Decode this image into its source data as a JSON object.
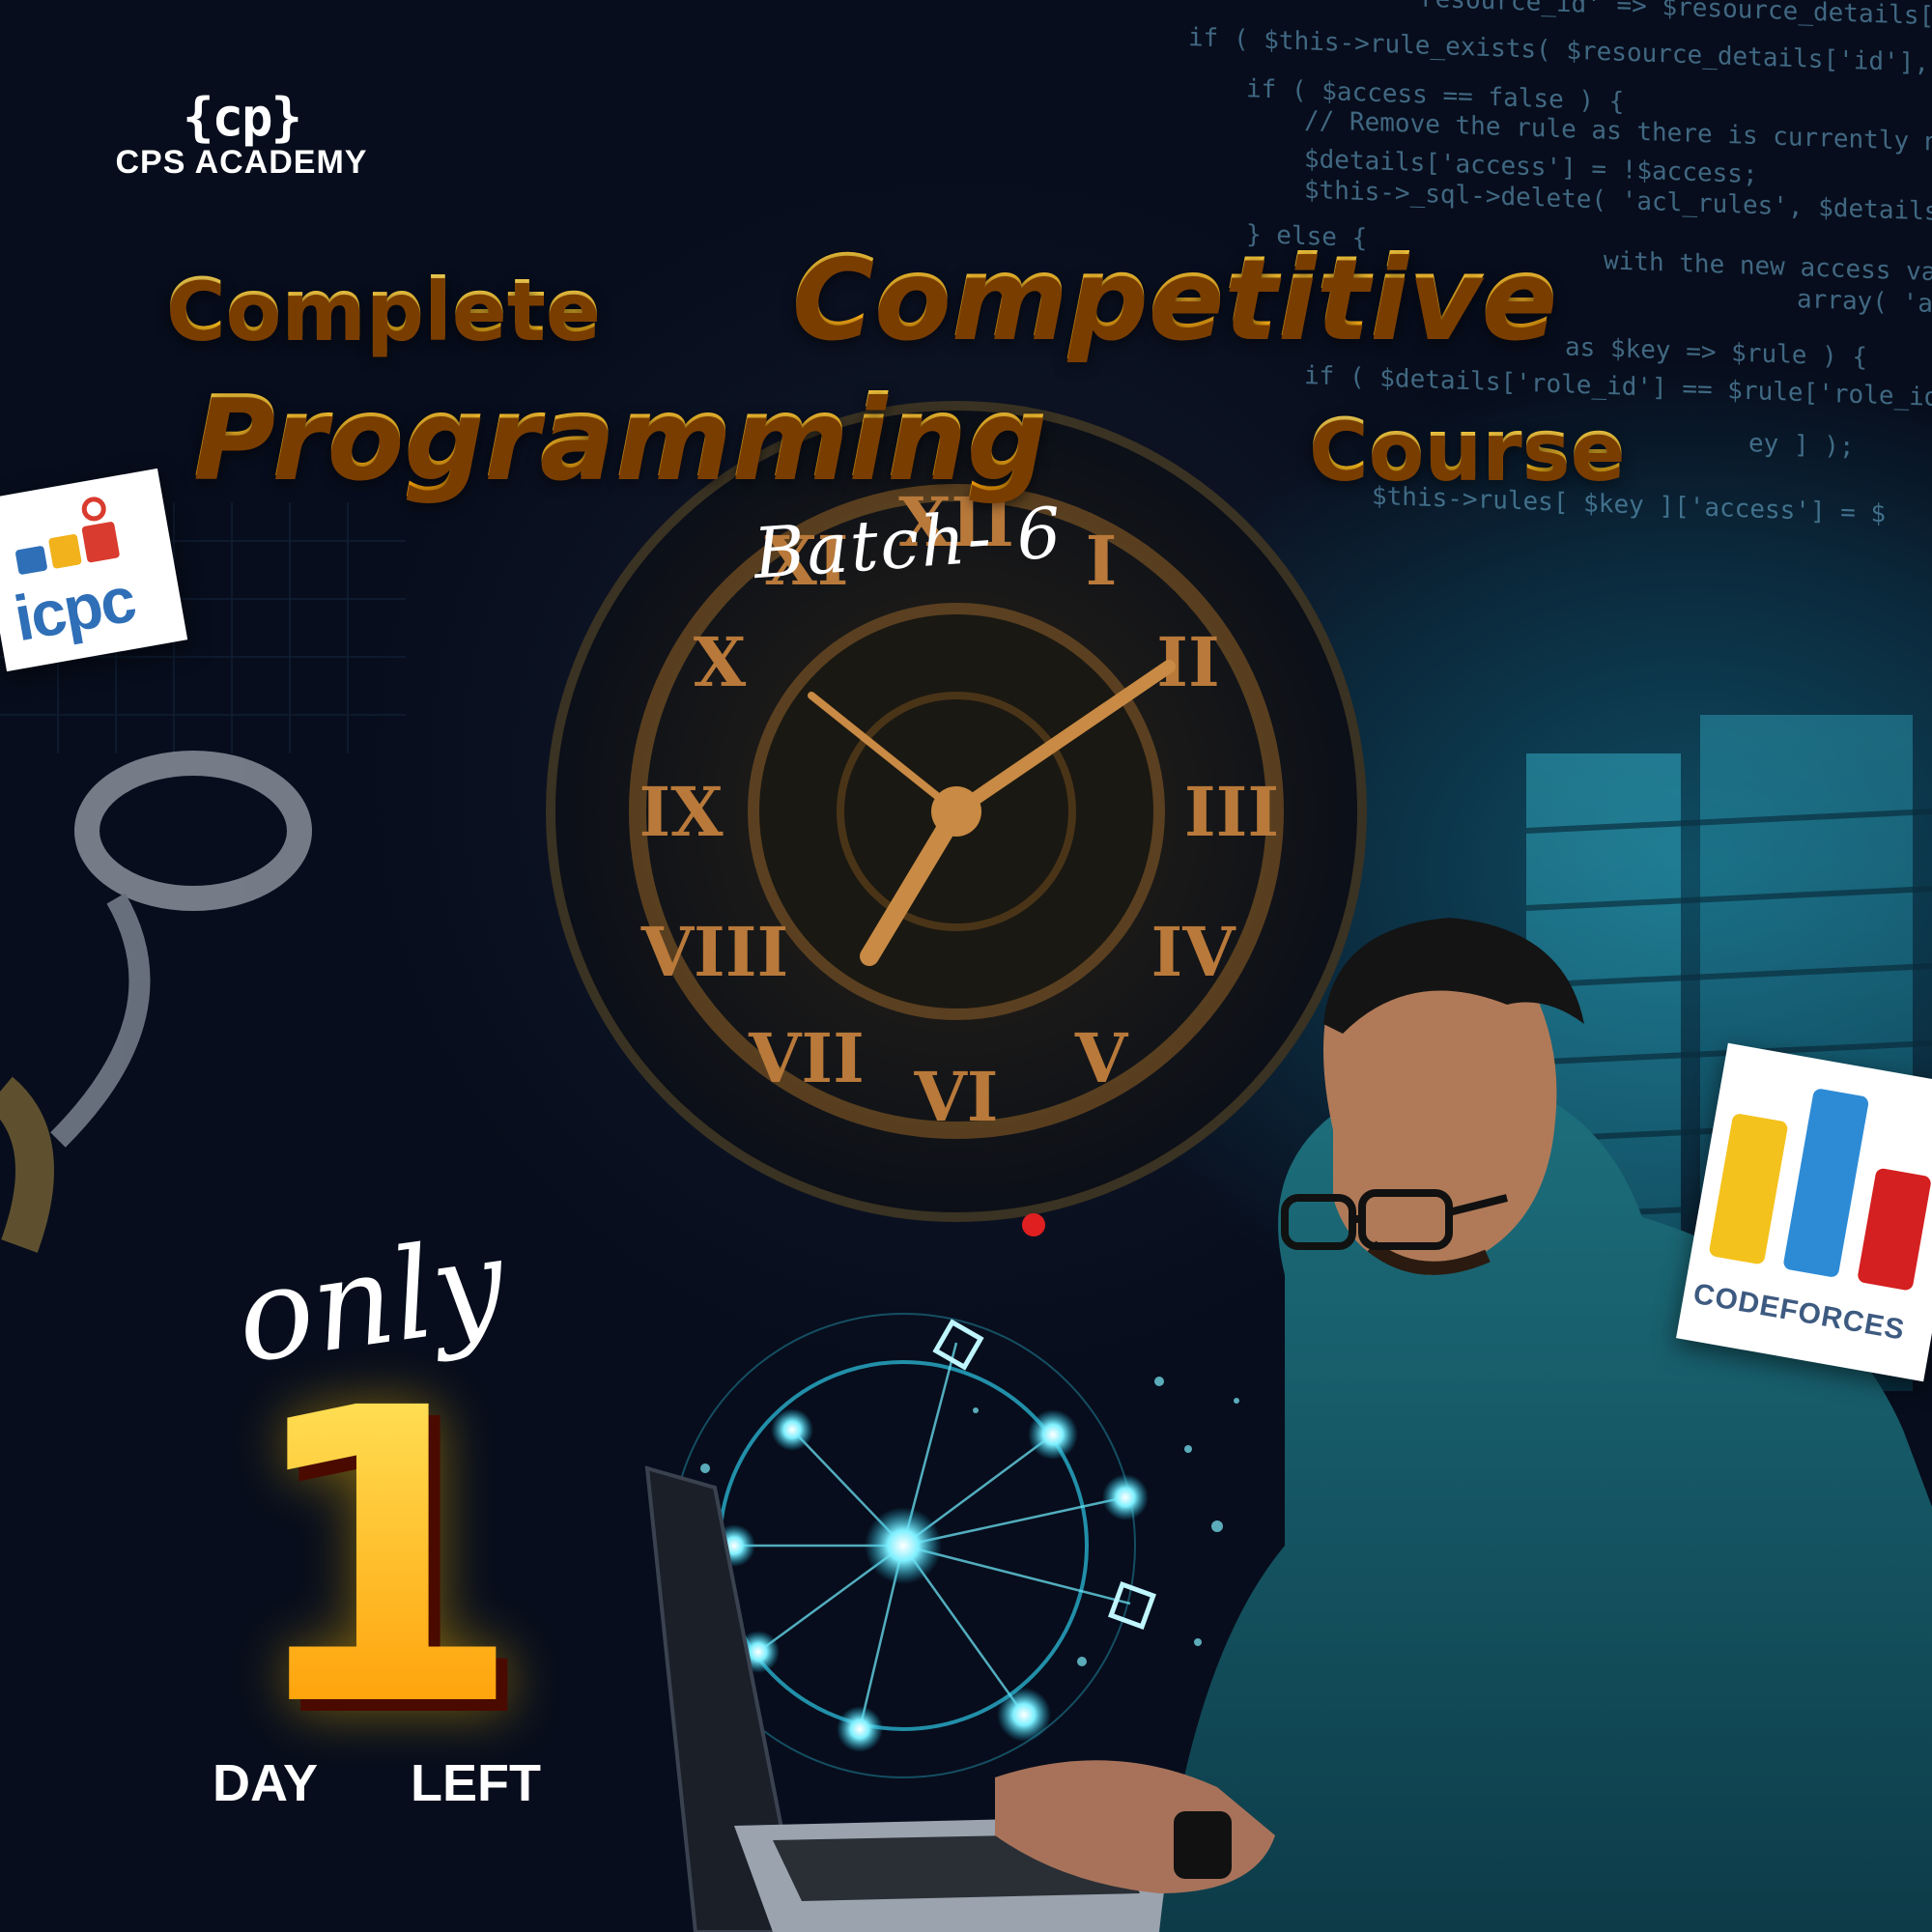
{
  "brand": {
    "logo_mark": "{cp}",
    "name": "CPS ACADEMY"
  },
  "title": {
    "word1": "Complete",
    "word2": "Competitive",
    "word3": "Programming",
    "word4": "Course"
  },
  "batch": "Batch- 6",
  "countdown": {
    "prefix": "only",
    "value": "1",
    "unit": "DAY",
    "suffix": "LEFT"
  },
  "badges": {
    "icpc": "icpc",
    "codeforces": "CODEFORCES"
  },
  "background_code": [
    "resource_id'   => $resource_details['id'",
    "if ( $this->rule_exists( $resource_details['id'], $",
    "if ( $access == false ) {",
    "// Remove the rule as there is currently no r",
    "$details['access'] = !$access;",
    "$this->_sql->delete( 'acl_rules', $details );",
    "} else {",
    "with the new access value",
    "array( 'acc",
    "as $key => $rule ) {",
    "if ( $details['role_id'] == $rule['role_id']",
    "ey ] );",
    "$this->rules[ $key ]['access'] = $"
  ],
  "colors": {
    "accent": "#ffb300",
    "accent_dark": "#7a3d00",
    "background": "#070d1c",
    "cyan": "#1fb6d9"
  }
}
